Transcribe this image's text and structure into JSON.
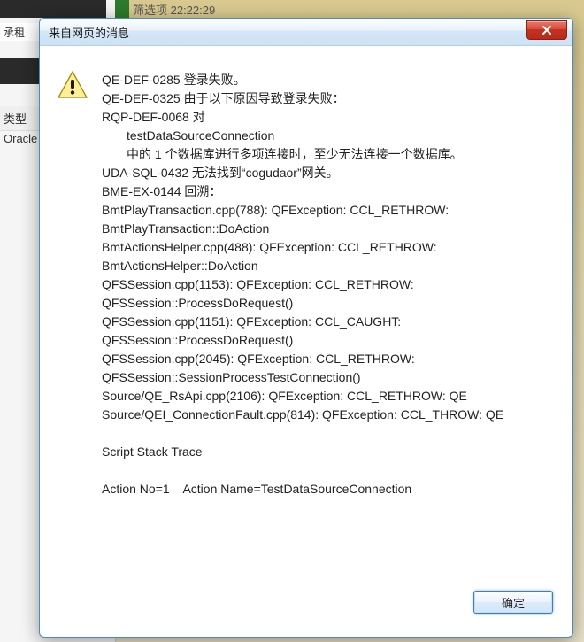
{
  "background": {
    "tab_label": "承租",
    "col_header": "类型",
    "row1": "Oracle",
    "top_fragment": "筛选项  22:22:29"
  },
  "dialog": {
    "title": "来自网页的消息",
    "close_tooltip": "关闭",
    "ok_label": "确定",
    "message_lines": [
      "QE-DEF-0285 登录失败。",
      "QE-DEF-0325 由于以下原因导致登录失败：",
      "RQP-DEF-0068 对",
      "    testDataSourceConnection",
      "    中的 1 个数据库进行多项连接时，至少无法连接一个数据库。",
      "UDA-SQL-0432 无法找到“cogudaor”网关。",
      "BME-EX-0144 回溯：",
      "BmtPlayTransaction.cpp(788): QFException: CCL_RETHROW: BmtPlayTransaction::DoAction",
      "BmtActionsHelper.cpp(488): QFException: CCL_RETHROW: BmtActionsHelper::DoAction",
      "QFSSession.cpp(1153): QFException: CCL_RETHROW: QFSSession::ProcessDoRequest()",
      "QFSSession.cpp(1151): QFException: CCL_CAUGHT: QFSSession::ProcessDoRequest()",
      "QFSSession.cpp(2045): QFException: CCL_RETHROW: QFSSession::SessionProcessTestConnection()",
      "Source/QE_RsApi.cpp(2106): QFException: CCL_RETHROW: QE",
      "Source/QEI_ConnectionFault.cpp(814): QFException: CCL_THROW: QE",
      "",
      "Script Stack Trace",
      "",
      "Action No=1    Action Name=TestDataSourceConnection"
    ]
  }
}
